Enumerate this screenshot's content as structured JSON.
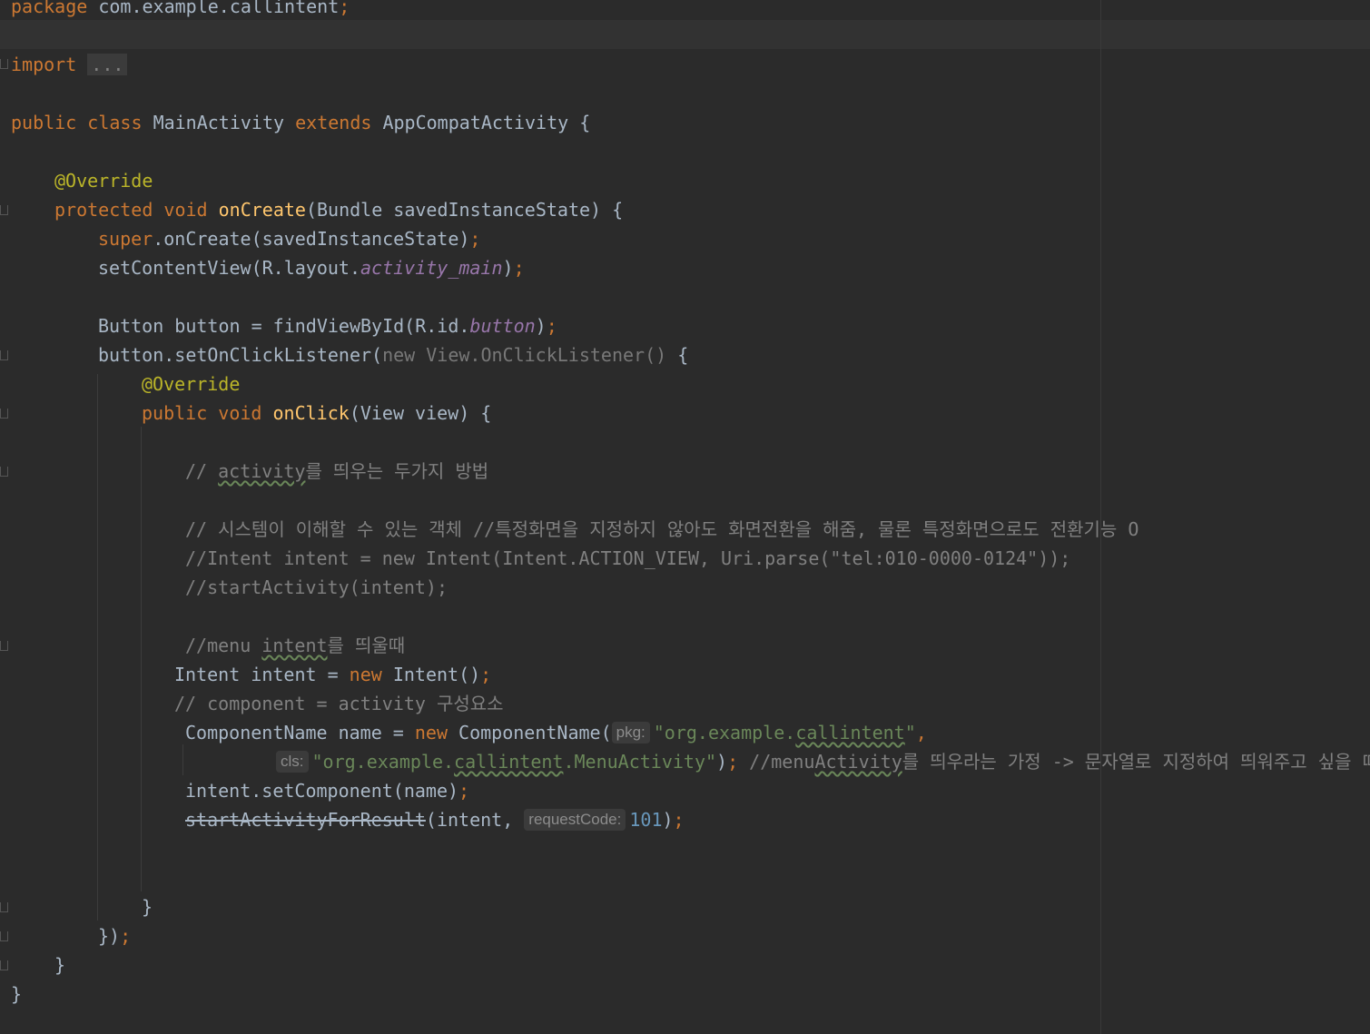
{
  "lines": {
    "l1": {
      "kw": "package",
      "pkg": "com.example.callintent",
      "semi": ";"
    },
    "l3": {
      "kw": "import",
      "fold": "..."
    },
    "l5": {
      "kw1": "public",
      "kw2": "class",
      "name": "MainActivity",
      "kw3": "extends",
      "parent": "AppCompatActivity",
      "brace": "{"
    },
    "l7": {
      "ann": "@Override"
    },
    "l8": {
      "kw1": "protected",
      "kw2": "void",
      "fn": "onCreate",
      "params": "(Bundle savedInstanceState) {"
    },
    "l9": {
      "kw": "super",
      "rest": ".onCreate(savedInstanceState)",
      "semi": ";"
    },
    "l10": {
      "pre": "setContentView(R.layout.",
      "fld": "activity_main",
      "post": ")",
      "semi": ";"
    },
    "l12": {
      "pre": "Button button = findViewById(R.id.",
      "fld": "button",
      "post": ")",
      "semi": ";"
    },
    "l13": {
      "pre": "button.setOnClickListener(",
      "gray": "new View.OnClickListener()",
      "post": " {"
    },
    "l14": {
      "ann": "@Override"
    },
    "l15": {
      "kw1": "public",
      "kw2": "void",
      "fn": "onClick",
      "params": "(View view) {"
    },
    "l17": {
      "c1": "// ",
      "c2": "activity",
      "c3": "를 띄우는 두가지 방법"
    },
    "l19": {
      "c": "// 시스템이 이해할 수 있는 객체 //특정화면을 지정하지 않아도 화면전환을 해줌, 물론 특정화면으로도 전환기능 O"
    },
    "l20": {
      "c": "//Intent intent = new Intent(Intent.ACTION_VIEW, Uri.parse(\"tel:010-0000-0124\"));"
    },
    "l21": {
      "c": "//startActivity(intent);"
    },
    "l23": {
      "c1": "//menu ",
      "c2": "intent",
      "c3": "를 띄울때"
    },
    "l24": {
      "pre": "Intent intent = ",
      "kw": "new",
      "post": " Intent()",
      "semi": ";"
    },
    "l25": {
      "c": "// component = activity 구성요소"
    },
    "l26": {
      "pre": "ComponentName name = ",
      "kw": "new",
      "post": " ComponentName(",
      "hint": "pkg:",
      "s1": "\"org.example.",
      "s2": "callintent",
      "s3": "\"",
      "comma": ","
    },
    "l27": {
      "hint": "cls:",
      "s1": "\"org.example.",
      "s2": "callintent",
      "s3": ".MenuActivity\"",
      "post": ")",
      "semi": ";",
      "c1": " //menu",
      "c2": "Activity",
      "c3": "를 띄우라는 가정 -> 문자열로 지정하여 띄워주고 싶을 때"
    },
    "l28": {
      "pre": "intent.setComponent(name)",
      "semi": ";"
    },
    "l29": {
      "strike": "startActivityForResult",
      "pre": "(intent, ",
      "hint": "requestCode:",
      "num": "101",
      "post": ")",
      "semi": ";"
    },
    "l32": {
      "t": "}"
    },
    "l33": {
      "t": "})",
      "semi": ";"
    },
    "l34": {
      "t": "}"
    },
    "l35": {
      "t": "}"
    }
  }
}
